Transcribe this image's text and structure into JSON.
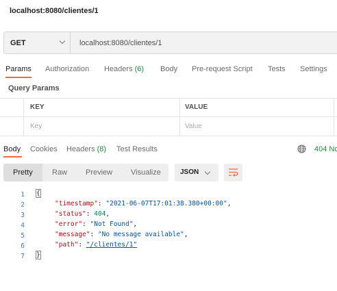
{
  "window": {
    "title": "localhost:8080/clientes/1"
  },
  "request": {
    "method": "GET",
    "url": "localhost:8080/clientes/1"
  },
  "request_tabs": [
    {
      "label": "Params",
      "count": ""
    },
    {
      "label": "Authorization",
      "count": ""
    },
    {
      "label": "Headers",
      "count": "(6)"
    },
    {
      "label": "Body",
      "count": ""
    },
    {
      "label": "Pre-request Script",
      "count": ""
    },
    {
      "label": "Tests",
      "count": ""
    },
    {
      "label": "Settings",
      "count": ""
    }
  ],
  "query_params": {
    "title": "Query Params",
    "columns": [
      "KEY",
      "VALUE"
    ],
    "placeholders": {
      "key": "Key",
      "value": "Value"
    }
  },
  "response_tabs": [
    {
      "label": "Body",
      "count": ""
    },
    {
      "label": "Cookies",
      "count": ""
    },
    {
      "label": "Headers",
      "count": "(8)"
    },
    {
      "label": "Test Results",
      "count": ""
    }
  ],
  "response_status": "404 No",
  "format_tabs": [
    "Pretty",
    "Raw",
    "Preview",
    "Visualize"
  ],
  "format_select": "JSON",
  "json_lines": {
    "numbers": [
      "1",
      "2",
      "3",
      "4",
      "5",
      "6",
      "7"
    ],
    "open": "{",
    "close": "}",
    "timestamp_key": "\"timestamp\"",
    "timestamp_val": "\"2021-06-07T17:01:38.380+00:00\"",
    "status_key": "\"status\"",
    "status_val": "404",
    "error_key": "\"error\"",
    "error_val": "\"Not Found\"",
    "message_key": "\"message\"",
    "message_val": "\"No message available\"",
    "path_key": "\"path\"",
    "path_val": "\"/clientes/1\""
  },
  "colors": {
    "accent": "#f26b3a",
    "success_green": "#1f8a3b",
    "json_key": "#a31515",
    "json_string": "#0451a5",
    "json_number": "#098658"
  }
}
